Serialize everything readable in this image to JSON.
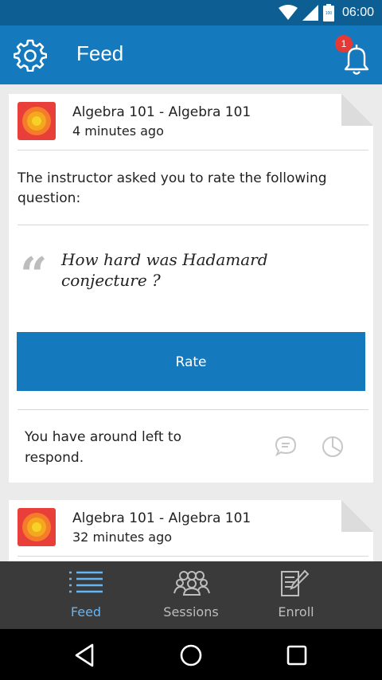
{
  "status_bar": {
    "time": "06:00",
    "battery_label": "100"
  },
  "app_bar": {
    "title": "Feed",
    "notification_count": "1"
  },
  "feed": [
    {
      "course": "Algebra 101 - Algebra 101",
      "time_ago": "4 minutes ago",
      "prompt": "The instructor asked you to rate the following question:",
      "question": "How hard was Hadamard conjecture ?",
      "action_label": "Rate",
      "time_left_text": "You have around  left to respond."
    },
    {
      "course": "Algebra 101 - Algebra 101",
      "time_ago": "32 minutes ago"
    }
  ],
  "tabs": [
    {
      "label": "Feed",
      "icon": "list-icon",
      "active": true
    },
    {
      "label": "Sessions",
      "icon": "group-icon",
      "active": false
    },
    {
      "label": "Enroll",
      "icon": "edit-document-icon",
      "active": false
    }
  ],
  "colors": {
    "primary": "#1579be",
    "status_bar": "#0d5f93",
    "tab_bar": "#3a3a3a",
    "tab_active": "#64b5f6",
    "tab_inactive": "#bdbdbd",
    "badge": "#e53935"
  }
}
